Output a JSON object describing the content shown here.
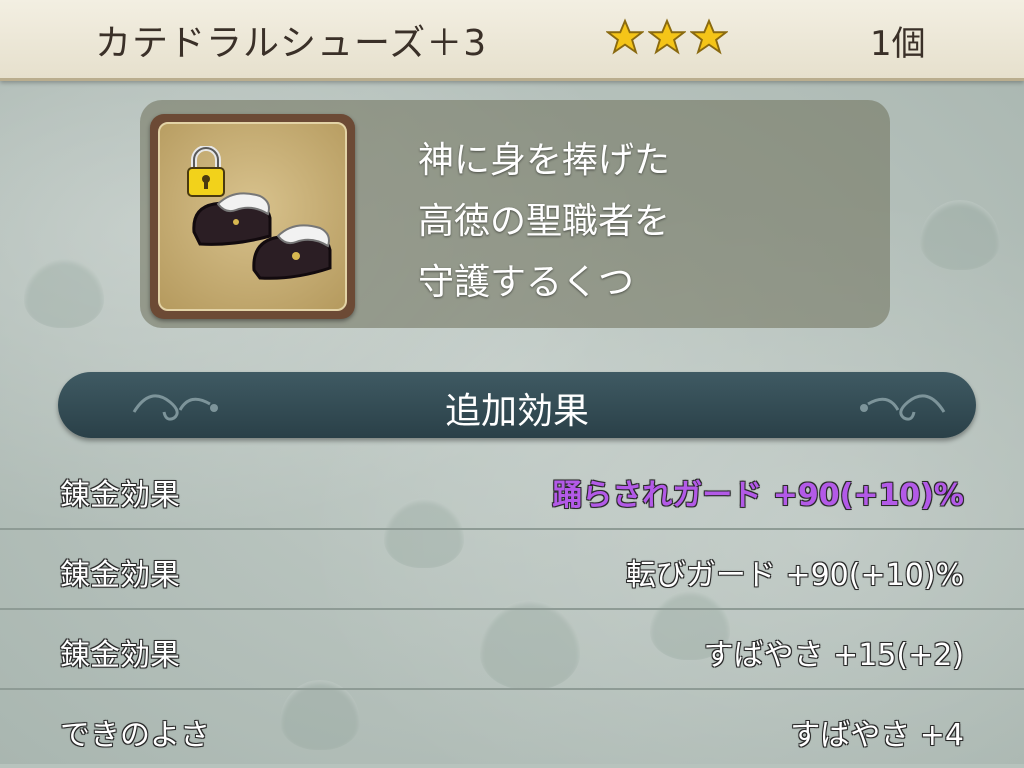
{
  "header": {
    "item_name": "カテドラルシューズ＋3",
    "rarity_stars": 3,
    "count": "1個"
  },
  "item": {
    "icon": "shoes-icon",
    "locked": true,
    "description_lines": [
      "神に身を捧げた",
      "高徳の聖職者を",
      "守護するくつ"
    ]
  },
  "section": {
    "title": "追加効果"
  },
  "effects": [
    {
      "label": "錬金効果",
      "value": "踊らされガード +90(+10)%",
      "highlight": true
    },
    {
      "label": "錬金効果",
      "value": "転びガード +90(+10)%",
      "highlight": false
    },
    {
      "label": "錬金効果",
      "value": "すばやさ +15(+2)",
      "highlight": false
    },
    {
      "label": "できのよさ",
      "value": "すばやさ +4",
      "highlight": false
    }
  ],
  "colors": {
    "star": "#f5c518",
    "highlight_text": "#b35ae8",
    "banner": "#2f4850"
  }
}
